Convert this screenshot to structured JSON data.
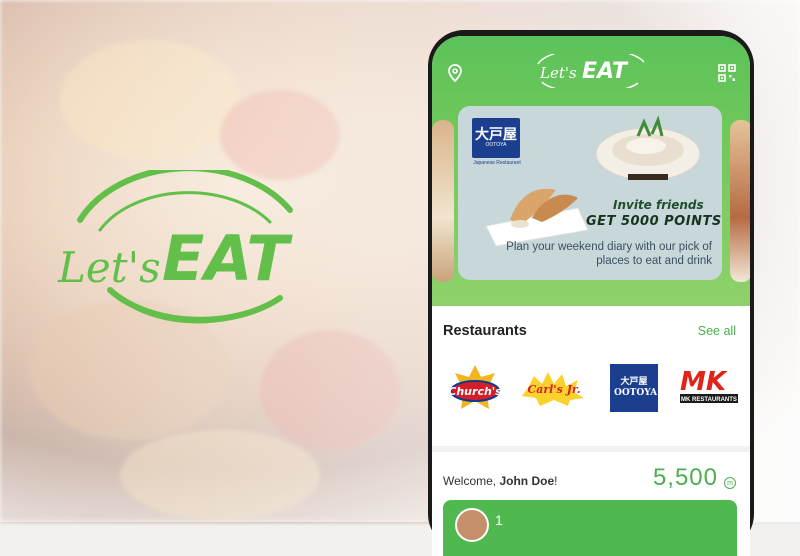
{
  "brand": {
    "logo_text_lets": "Let's",
    "logo_text_eat": "EAT"
  },
  "header": {
    "location_icon": "location-pin-icon",
    "qr_icon": "qr-code-icon"
  },
  "promo": {
    "brand_name": "大戸屋",
    "brand_en": "OOTOYA",
    "brand_sub": "Japanese Restaurant",
    "title1": "Invite friends",
    "title2": "GET 5000 POINTS",
    "description": "Plan your weekend diary with our pick of places to eat and drink"
  },
  "restaurants": {
    "title": "Restaurants",
    "see_all": "See all",
    "items": [
      {
        "name": "Church's"
      },
      {
        "name": "Carl's Jr."
      },
      {
        "name": "大戸屋 OOTOYA"
      },
      {
        "name": "MK RESTAURANTS"
      }
    ]
  },
  "account": {
    "welcome_prefix": "Welcome, ",
    "user_name": "John Doe",
    "welcome_suffix": "!",
    "points": "5,500",
    "points_unit": "m",
    "card_number_partial": "1"
  },
  "colors": {
    "accent": "#4caf50",
    "header_green": "#6fc85a"
  }
}
